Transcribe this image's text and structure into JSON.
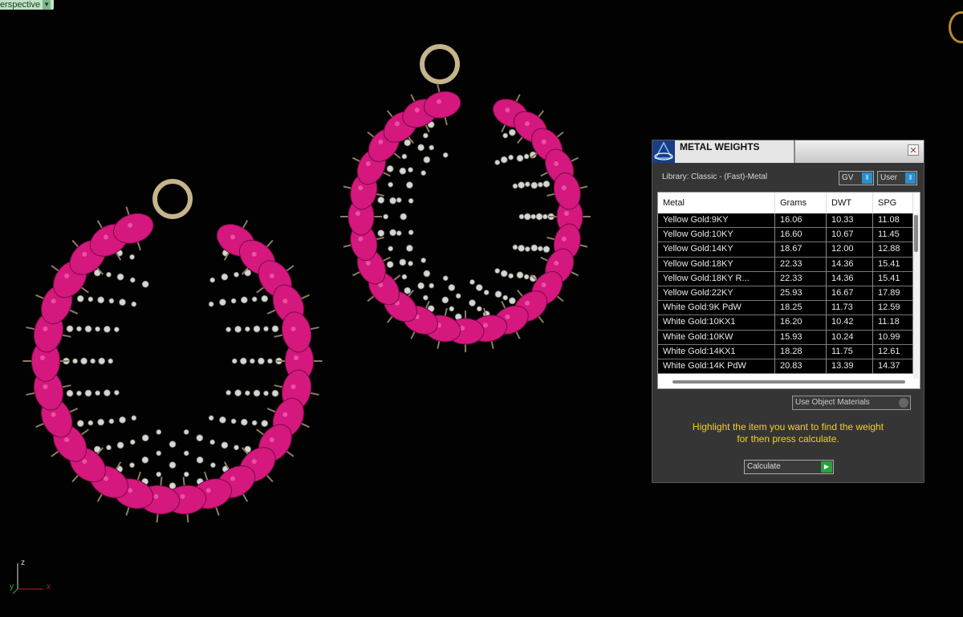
{
  "viewport": {
    "label": "erspective",
    "axis": {
      "z": "z",
      "y": "y",
      "x": "x"
    }
  },
  "panel": {
    "title": "METAL WEIGHTS",
    "close_glyph": "✕",
    "library_text": "Library: Classic - (Fast)-Metal",
    "gv_label": "GV",
    "user_label": "User",
    "columns": [
      "Metal",
      "Grams",
      "DWT",
      "SPG"
    ],
    "rows": [
      [
        "Yellow Gold:9KY",
        "16.06",
        "10.33",
        "11.08"
      ],
      [
        "Yellow Gold:10KY",
        "16.60",
        "10.67",
        "11.45"
      ],
      [
        "Yellow Gold:14KY",
        "18.67",
        "12.00",
        "12.88"
      ],
      [
        "Yellow Gold:18KY",
        "22.33",
        "14.36",
        "15.41"
      ],
      [
        "Yellow Gold:18KY R...",
        "22.33",
        "14.36",
        "15.41"
      ],
      [
        "Yellow Gold:22KY",
        "25.93",
        "16.67",
        "17.89"
      ],
      [
        "White Gold:9K PdW",
        "18.25",
        "11.73",
        "12.59"
      ],
      [
        "White Gold:10KX1",
        "16.20",
        "10.42",
        "11.18"
      ],
      [
        "White Gold:10KW",
        "15.93",
        "10.24",
        "10.99"
      ],
      [
        "White Gold:14KX1",
        "18.28",
        "11.75",
        "12.61"
      ],
      [
        "White Gold:14K PdW",
        "20.83",
        "13.39",
        "14.37"
      ]
    ],
    "use_object_materials": "Use Object Materials",
    "instruction_line1": "Highlight the item you want to find the weight",
    "instruction_line2": "for then press calculate.",
    "calculate_label": "Calculate"
  },
  "colors": {
    "ruby": "#d4187e",
    "diamond": "#e8eef3",
    "metal": "#8a7d5e",
    "instruction": "#f2d21c"
  }
}
